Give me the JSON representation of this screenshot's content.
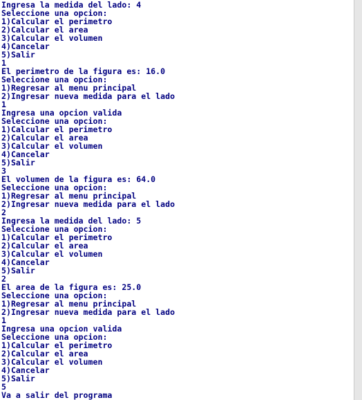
{
  "console": {
    "lines": [
      "Ingresa la medida del lado: 4",
      "Seleccione una opcion:",
      "1)Calcular el perimetro",
      "2)Calcular el area",
      "3)Calcular el volumen",
      "4)Cancelar",
      "5)Salir",
      "1",
      "El perimetro de la figura es: 16.0",
      "Seleccione una opcion:",
      "1)Regresar al menu principal",
      "2)Ingresar nueva medida para el lado",
      "1",
      "Ingresa una opcion valida",
      "Seleccione una opcion:",
      "1)Calcular el perimetro",
      "2)Calcular el area",
      "3)Calcular el volumen",
      "4)Cancelar",
      "5)Salir",
      "3",
      "El volumen de la figura es: 64.0",
      "Seleccione una opcion:",
      "1)Regresar al menu principal",
      "2)Ingresar nueva medida para el lado",
      "2",
      "Ingresa la medida del lado: 5",
      "Seleccione una opcion:",
      "1)Calcular el perimetro",
      "2)Calcular el area",
      "3)Calcular el volumen",
      "4)Cancelar",
      "5)Salir",
      "2",
      "El area de la figura es: 25.0",
      "Seleccione una opcion:",
      "1)Regresar al menu principal",
      "2)Ingresar nueva medida para el lado",
      "1",
      "Ingresa una opcion valida",
      "Seleccione una opcion:",
      "1)Calcular el perimetro",
      "2)Calcular el area",
      "3)Calcular el volumen",
      "4)Cancelar",
      "5)Salir",
      "5",
      "Va a salir del programa"
    ],
    "text_color": "#000080",
    "background_color": "#ffffff"
  }
}
